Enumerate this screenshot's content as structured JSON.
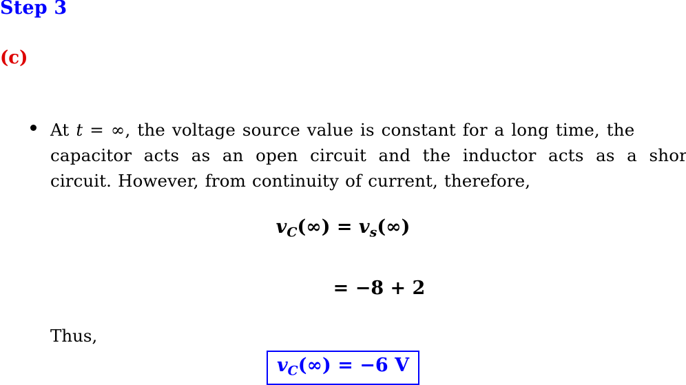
{
  "page": {
    "background_color": "#ffffff",
    "text_color": "#000000"
  },
  "heading": {
    "label": "Step 3",
    "color": "#0000ff"
  },
  "part": {
    "label": "(c)",
    "color": "#dd0000"
  },
  "bullet": {
    "marker": "•",
    "lines": [
      {
        "segments": [
          {
            "text": "At ",
            "style": "roman"
          },
          {
            "text": "t",
            "style": "math-italic"
          },
          {
            "text": " = ∞, the voltage source value is constant for a long time, the",
            "style": "roman"
          }
        ],
        "plain": "At t = ∞, the voltage source value is constant for a long time, the"
      },
      {
        "segments": [
          {
            "text": "capacitor acts as an open circuit and the inductor acts as a short",
            "style": "roman"
          }
        ],
        "plain": "capacitor acts as an open circuit and the inductor acts as a short"
      },
      {
        "segments": [
          {
            "text": "circuit. However, from continuity of current, therefore,",
            "style": "roman"
          }
        ],
        "plain": "circuit. However, from continuity of current, therefore,"
      }
    ],
    "full_text": "At t = ∞, the voltage source value is constant for a long time, the capacitor acts as an open circuit and the inductor acts as a short circuit. However, from continuity of current, therefore,"
  },
  "equations": {
    "eq1": {
      "plain": "v_C(∞) = v_s(∞)",
      "var_left": "v",
      "sub_left": "C",
      "arg_left": "(∞)",
      "relation": " = ",
      "var_right": "v",
      "sub_right": "s",
      "arg_right": "(∞)"
    },
    "eq2": {
      "plain": "= −8 + 2",
      "body": "= −8 + 2"
    }
  },
  "thus": {
    "label": "Thus,"
  },
  "answer": {
    "plain": "v_C(∞) = −6 V",
    "var": "v",
    "sub": "C",
    "arg": "(∞)",
    "relation": " = −6",
    "unit": "V",
    "border_color": "#0000ff",
    "text_color": "#0000ff"
  }
}
